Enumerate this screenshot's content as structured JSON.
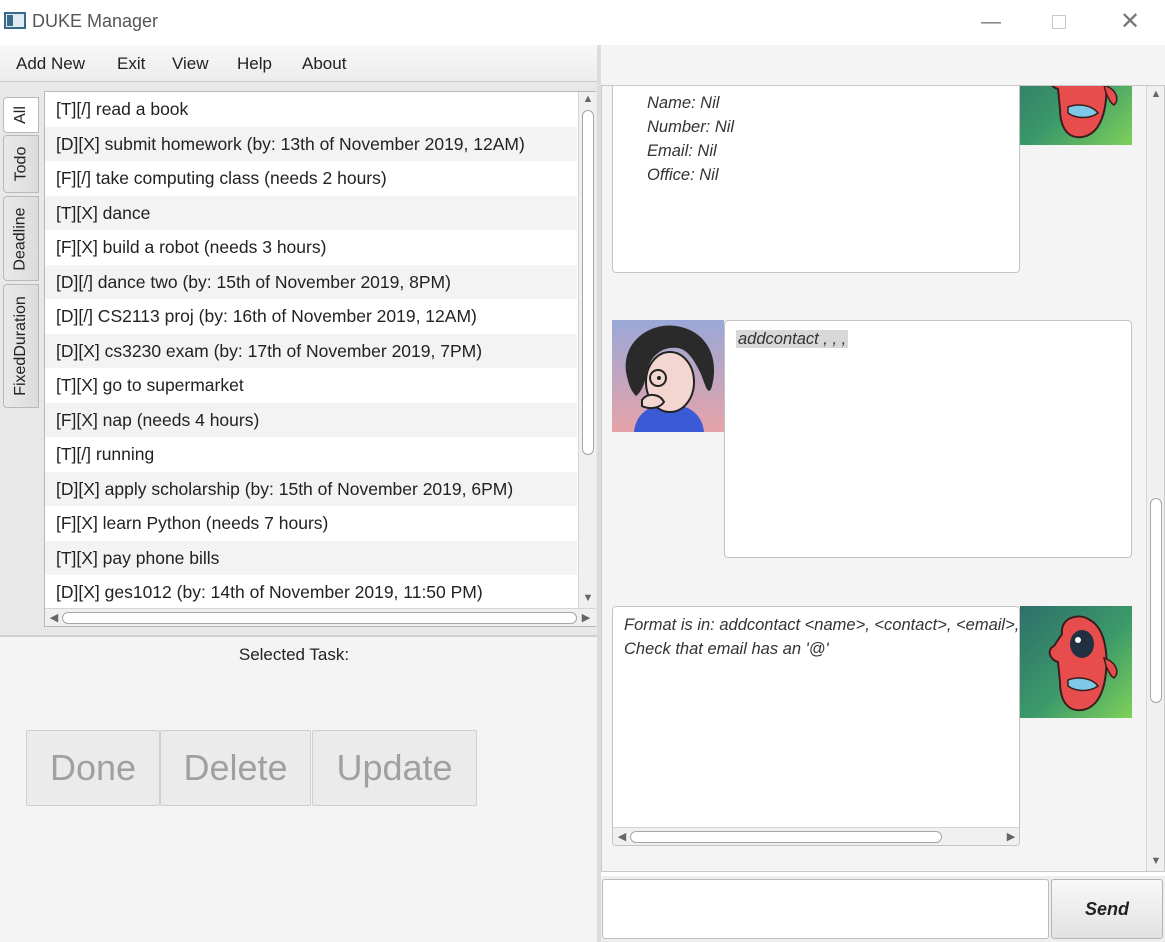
{
  "window": {
    "title": "DUKE Manager",
    "minimize": "—",
    "close": "✕"
  },
  "menu": [
    "Add New",
    "Exit",
    "View",
    "Help",
    "About"
  ],
  "tabs": [
    "All",
    "Todo",
    "Deadline",
    "FixedDuration"
  ],
  "selected_tab": "All",
  "tasks": [
    "[T][/] read a book",
    "[D][X] submit homework (by: 13th of November 2019, 12AM)",
    "[F][/] take computing class (needs 2 hours)",
    "[T][X] dance",
    "[F][X] build a robot (needs 3 hours)",
    "[D][/] dance two (by: 15th of November 2019, 8PM)",
    "[D][/] CS2113 proj (by: 16th of November 2019, 12AM)",
    "[D][X] cs3230 exam (by: 17th of November 2019, 7PM)",
    "[T][X] go to supermarket",
    "[F][X] nap (needs 4 hours)",
    "[T][/] running",
    "[D][X] apply scholarship (by: 15th of November 2019, 6PM)",
    "[F][X] learn Python (needs 7 hours)",
    "[T][X] pay phone bills",
    "[D][X] ges1012 (by: 14th of November 2019, 11:50 PM)"
  ],
  "selected_task_label": "Selected Task:",
  "actions": {
    "done": "Done",
    "delete": "Delete",
    "update": "Update"
  },
  "chat": {
    "contact_lines": [
      "Name: Nil",
      "Number: Nil",
      "Email: Nil",
      "Office: Nil"
    ],
    "user_message": "addcontact , , ,",
    "error_lines": [
      "Format is in: addcontact <name>, <contact>, <email>,",
      "Check that email has an '@'"
    ]
  },
  "input": {
    "value": "",
    "send_label": "Send"
  },
  "colors": {
    "duke_avatar": "#3b9a6a",
    "user_avatar_bg": "#e6a3a8",
    "highlight": "#d8d8d8"
  },
  "icons": [
    "app-icon",
    "duke-avatar",
    "user-avatar",
    "scroll-up-arrow",
    "scroll-down-arrow",
    "scroll-left-arrow",
    "scroll-right-arrow"
  ]
}
